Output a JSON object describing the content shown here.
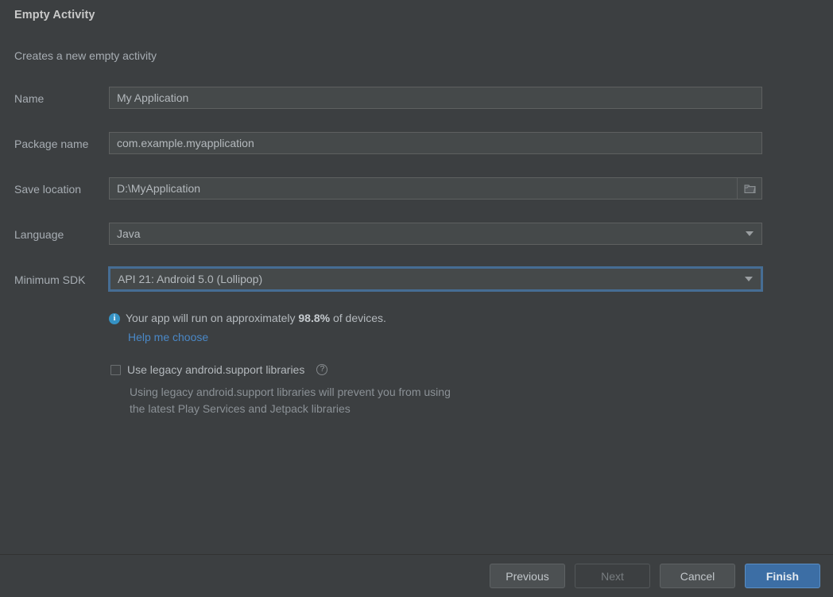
{
  "header": {
    "title": "Empty Activity",
    "subtitle": "Creates a new empty activity"
  },
  "form": {
    "fields": [
      {
        "label": "Name",
        "value": "My Application",
        "type": "text"
      },
      {
        "label": "Package name",
        "value": "com.example.myapplication",
        "type": "text"
      },
      {
        "label": "Save location",
        "value": "D:\\MyApplication",
        "type": "text-with-browse",
        "browse_icon": "folder-icon"
      },
      {
        "label": "Language",
        "value": "Java",
        "type": "dropdown",
        "dropdown_icon": "chevron-down-icon"
      },
      {
        "label": "Minimum SDK",
        "value": "API 21: Android 5.0 (Lollipop)",
        "type": "dropdown",
        "dropdown_icon": "chevron-down-icon",
        "focused": true
      }
    ]
  },
  "info": {
    "icon": "info-icon",
    "text_before": "Your app will run on approximately ",
    "percent": "98.8%",
    "text_after": " of devices.",
    "link_label": "Help me choose",
    "link_color": "#4a88c7"
  },
  "legacy": {
    "checkbox_checked": false,
    "label": "Use legacy android.support libraries",
    "help_icon": "question-mark-icon",
    "help_glyph": "?",
    "description_line1": "Using legacy android.support libraries will prevent you from using",
    "description_line2": "the latest Play Services and Jetpack libraries"
  },
  "footer": {
    "buttons": [
      {
        "label": "Previous",
        "state": "enabled"
      },
      {
        "label": "Next",
        "state": "disabled"
      },
      {
        "label": "Cancel",
        "state": "enabled"
      },
      {
        "label": "Finish",
        "state": "primary"
      }
    ]
  },
  "colors": {
    "background": "#3c3f41",
    "field_background": "#45494a",
    "accent_blue": "#3c6ea5",
    "focus_blue": "#466d94",
    "link_blue": "#4a88c7",
    "info_blue": "#3592c4"
  }
}
